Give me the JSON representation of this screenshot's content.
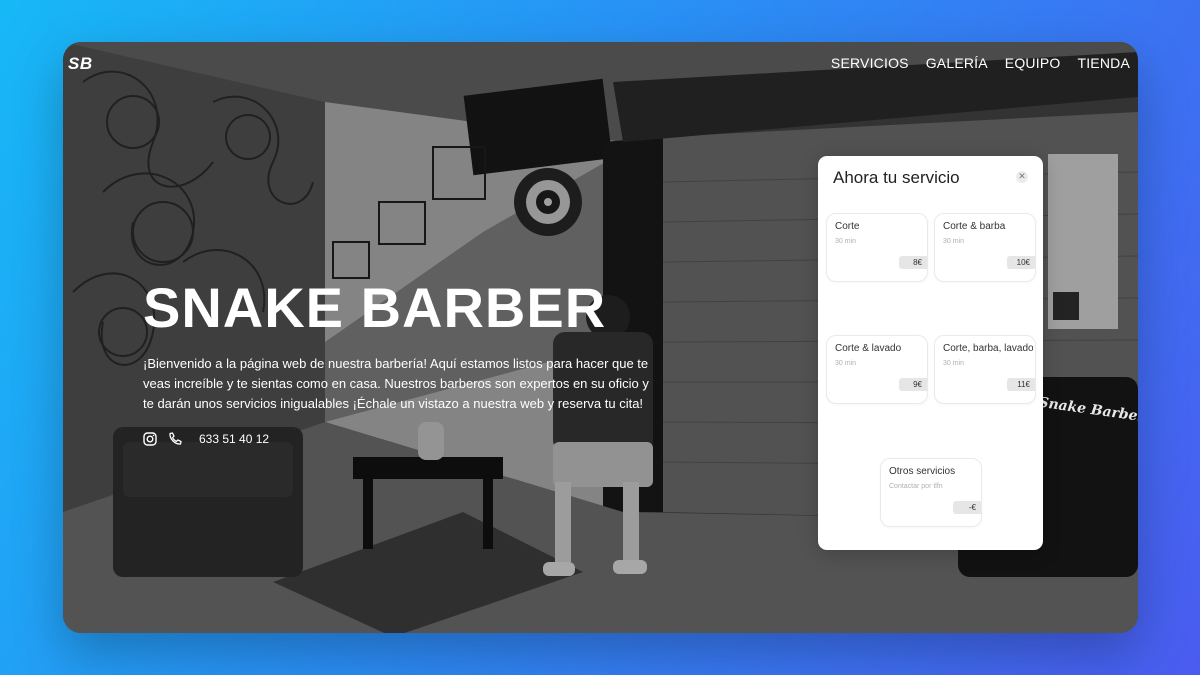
{
  "site": {
    "logo": "SB",
    "nav": [
      "SERVICIOS",
      "GALERÍA",
      "EQUIPO",
      "TIENDA"
    ]
  },
  "hero": {
    "title": "SNAKE BARBER",
    "description": "¡Bienvenido a la página web de nuestra barbería! Aquí estamos listos para hacer que te veas increíble y te sientas como en casa. Nuestros barberos son expertos en su oficio y te darán unos servicios inigualables ¡Échale un vistazo a nuestra web y reserva tu cita!",
    "phone": "633 51 40 12"
  },
  "background_sign": "Snake Barber",
  "panel": {
    "title": "Ahora tu servicio",
    "close_icon": "close-icon",
    "services": [
      {
        "name": "Corte",
        "duration": "30 min",
        "price": "8€"
      },
      {
        "name": "Corte & barba",
        "duration": "30 min",
        "price": "10€"
      },
      {
        "name": "Corte & lavado",
        "duration": "30 min",
        "price": "9€"
      },
      {
        "name": "Corte, barba, lavado",
        "duration": "30 min",
        "price": "11€"
      },
      {
        "name": "Otros servicios",
        "duration": "Contactar por tlfn",
        "price": "-€"
      }
    ]
  },
  "colors": {
    "background_start": "#17b8f6",
    "background_end": "#4a5cf0",
    "panel_bg": "#ffffff",
    "price_tag": "#e6e6e6"
  }
}
